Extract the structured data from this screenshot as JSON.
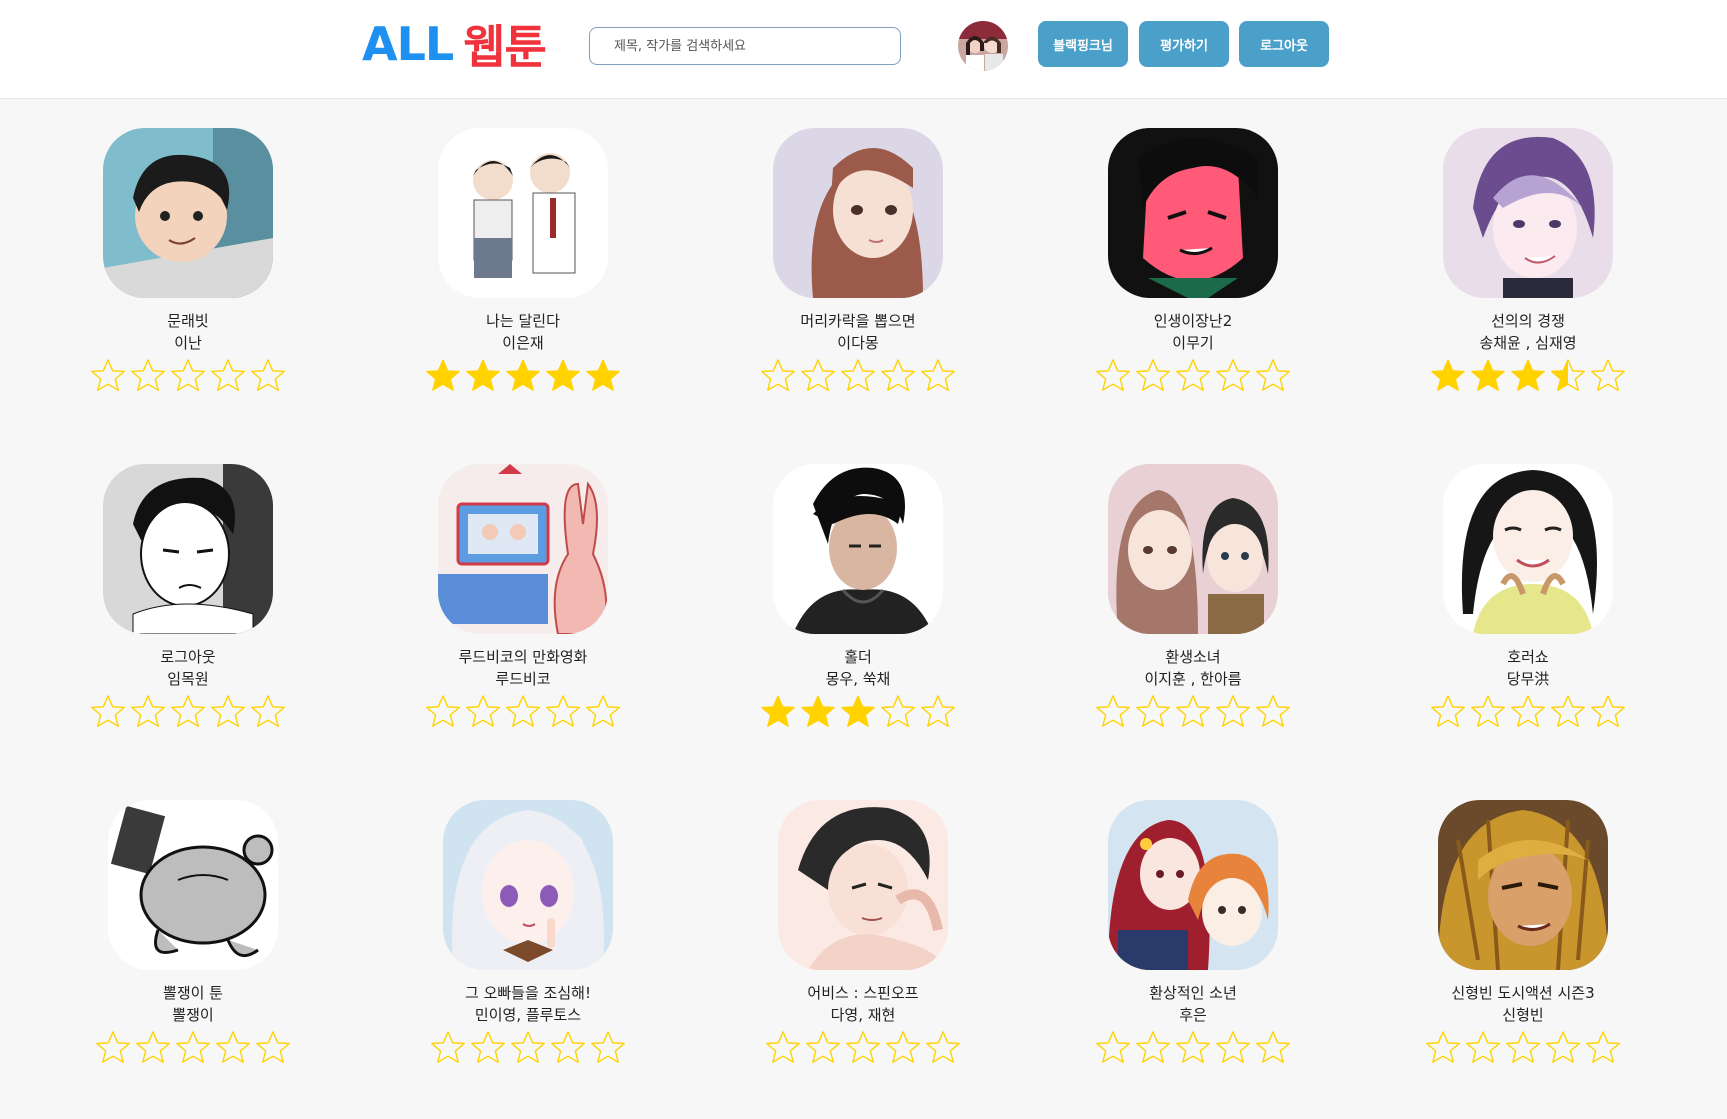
{
  "header": {
    "logo_all": "ALL",
    "logo_kr": "웹툰",
    "search_placeholder": "제목, 작가를 검색하세요",
    "user_button": "블랙핑크님",
    "rate_button": "평가하기",
    "logout_button": "로그아웃"
  },
  "colors": {
    "accent": "#4aa0c8",
    "logo_blue": "#1e90f0",
    "logo_red": "#f0323c",
    "star": "#ffd200"
  },
  "webtoons": [
    {
      "title": "문래빗",
      "author": "이난",
      "rating": 0
    },
    {
      "title": "나는 달린다",
      "author": "이은재",
      "rating": 5
    },
    {
      "title": "머리카락을 뽑으면",
      "author": "이다몽",
      "rating": 0
    },
    {
      "title": "인생이장난2",
      "author": "이무기",
      "rating": 0
    },
    {
      "title": "선의의 경쟁",
      "author": "송채윤 , 심재영",
      "rating": 3.5
    },
    {
      "title": "로그아웃",
      "author": "임목원",
      "rating": 0
    },
    {
      "title": "루드비코의 만화영화",
      "author": "루드비코",
      "rating": 0
    },
    {
      "title": "홀더",
      "author": "몽우, 쑥채",
      "rating": 3
    },
    {
      "title": "환생소녀",
      "author": "이지훈 , 한아름",
      "rating": 0
    },
    {
      "title": "호러쇼",
      "author": "당무洪",
      "rating": 0
    },
    {
      "title": "뽈쟁이 툰",
      "author": "뽈쟁이",
      "rating": 0
    },
    {
      "title": "그 오빠들을 조심해!",
      "author": "민이영, 플루토스",
      "rating": 0
    },
    {
      "title": "어비스 : 스핀오프",
      "author": "다영, 재현",
      "rating": 0
    },
    {
      "title": "환상적인 소년",
      "author": "후은",
      "rating": 0
    },
    {
      "title": "신형빈 도시액션 시즌3",
      "author": "신형빈",
      "rating": 0
    }
  ]
}
